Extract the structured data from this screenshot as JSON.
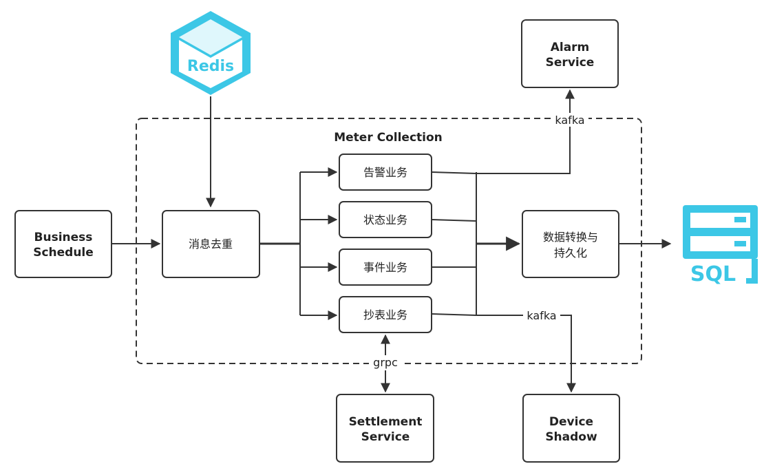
{
  "redis": {
    "label": "Redis",
    "color": "#3cc7e6"
  },
  "sql": {
    "label": "SQL",
    "color": "#3cc7e6"
  },
  "group": {
    "title": "Meter Collection"
  },
  "nodes": {
    "business": {
      "line1": "Business",
      "line2": "Schedule"
    },
    "dedup": {
      "label": "消息去重"
    },
    "alarm_biz": {
      "label": "告警业务"
    },
    "status_biz": {
      "label": "状态业务"
    },
    "event_biz": {
      "label": "事件业务"
    },
    "meter_biz": {
      "label": "抄表业务"
    },
    "convert": {
      "line1": "数据转换与",
      "line2": "持久化"
    },
    "alarm_service": {
      "line1": "Alarm",
      "line2": "Service"
    },
    "settlement": {
      "line1": "Settlement",
      "line2": "Service"
    },
    "shadow": {
      "line1": "Device",
      "line2": "Shadow"
    }
  },
  "edges": {
    "kafka_alarm": "kafka",
    "kafka_shadow": "kafka",
    "grpc": "grpc"
  }
}
